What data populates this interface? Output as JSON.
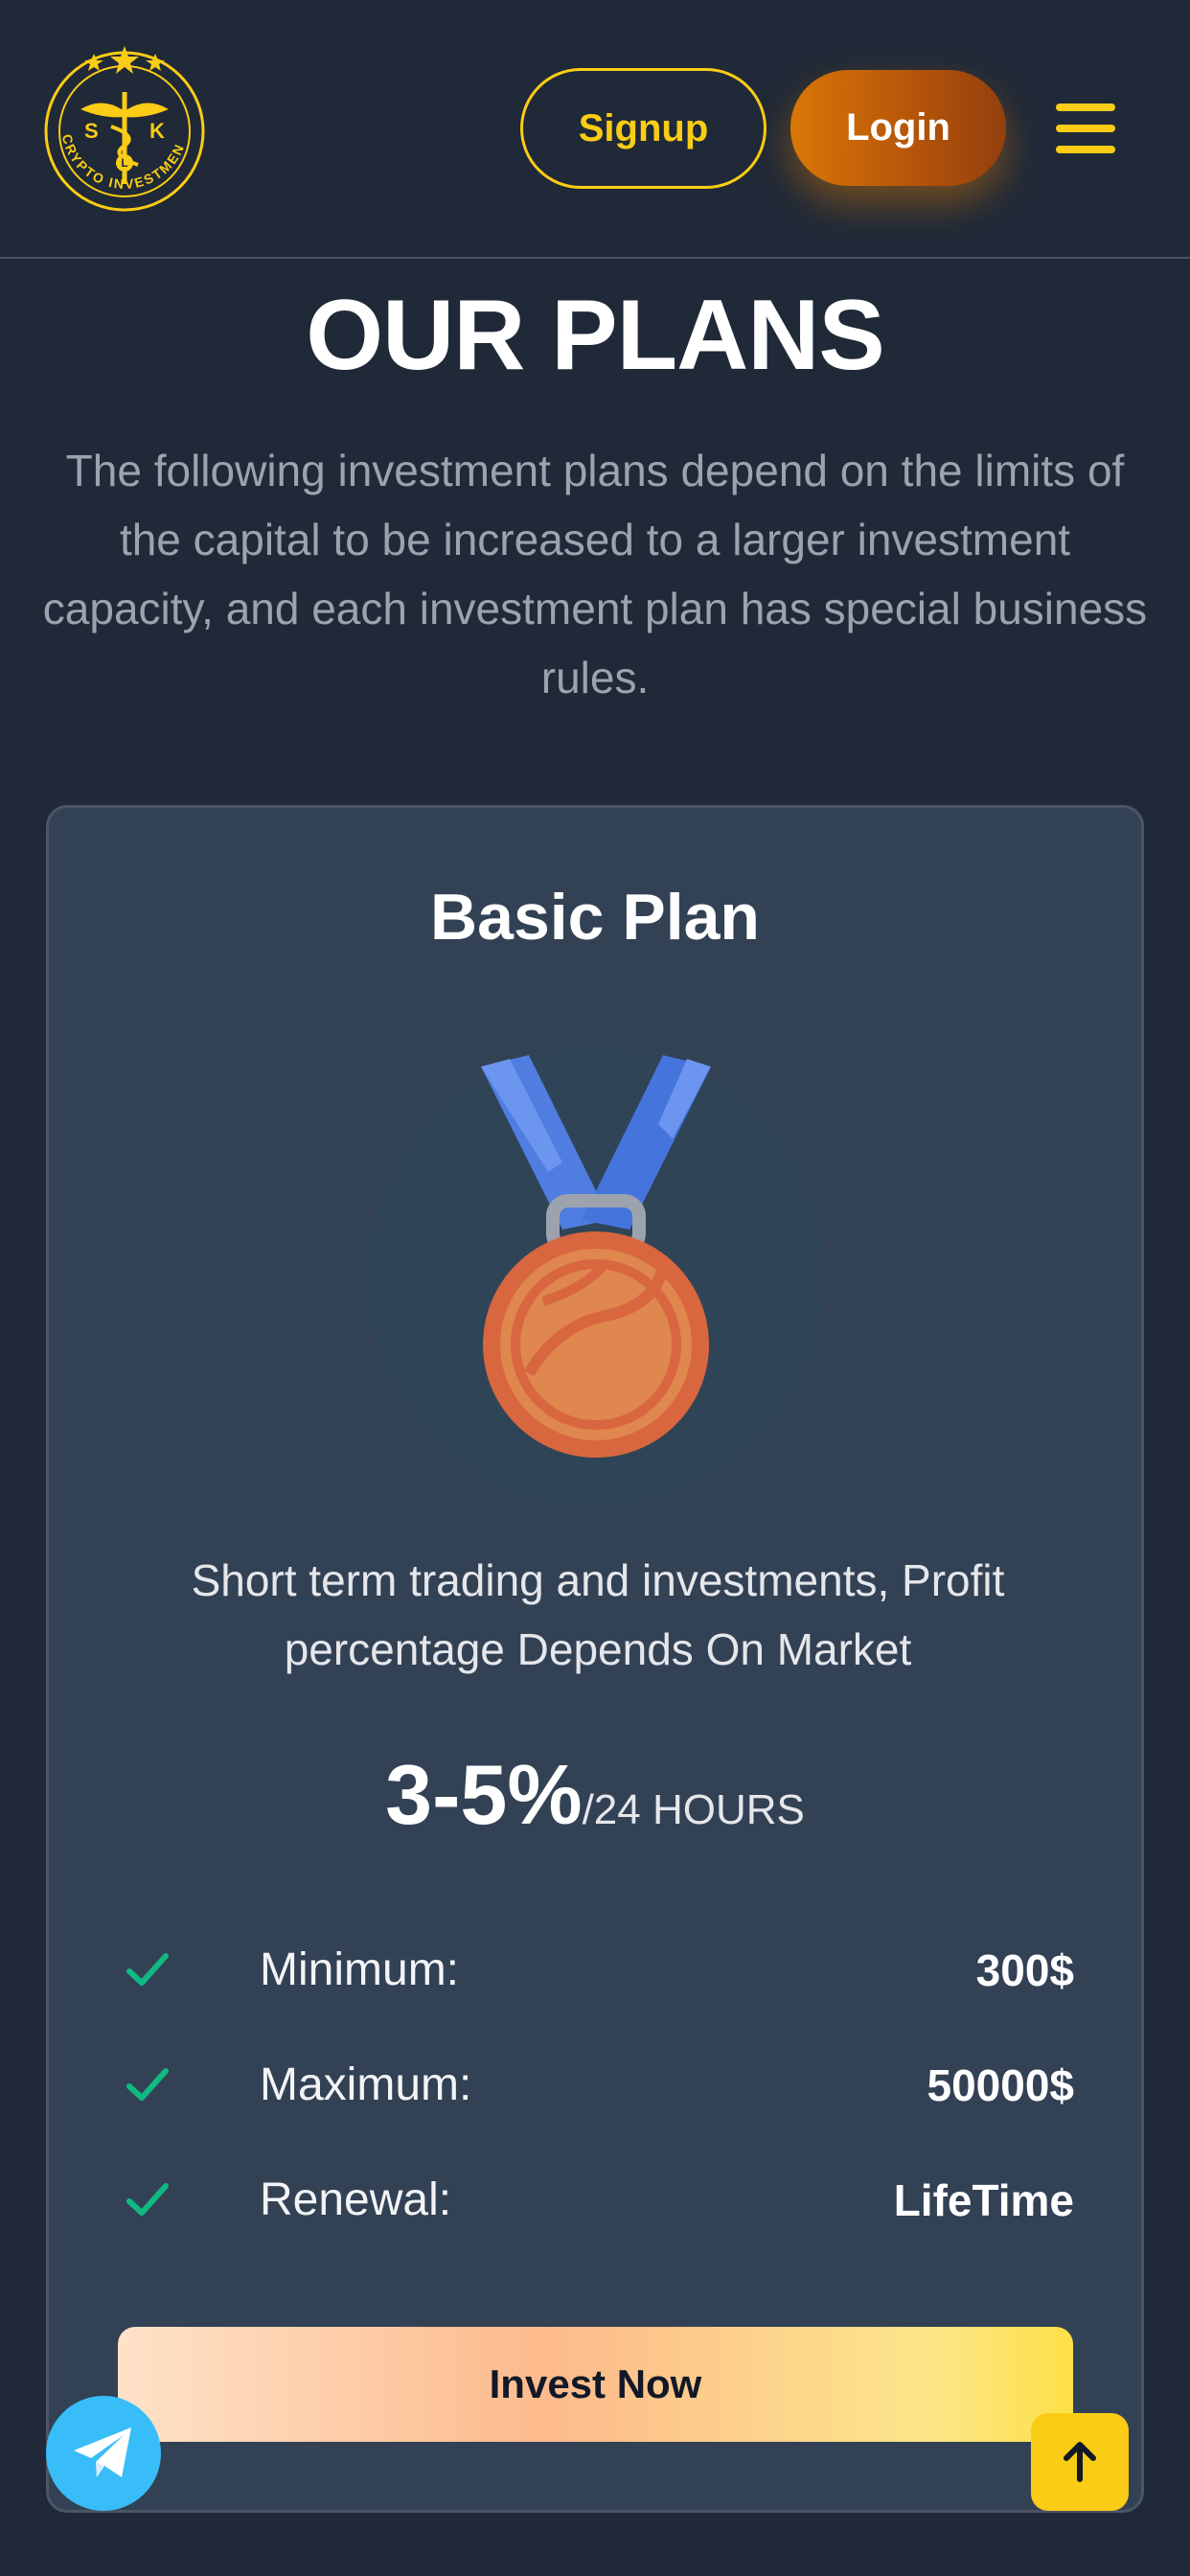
{
  "header": {
    "logo": {
      "initials": [
        "S",
        "K",
        "L"
      ],
      "ring_text": "CRYPTO INVESTMENT",
      "icon": "caduceus-logo-icon"
    },
    "signup_label": "Signup",
    "login_label": "Login",
    "menu_icon": "hamburger-menu-icon"
  },
  "page": {
    "title": "OUR PLANS",
    "intro": "The following investment plans depend on the limits of the capital to be increased to a larger investment capacity, and each investment plan has special business rules."
  },
  "plan": {
    "name": "Basic Plan",
    "badge_icon": "bronze-medal-icon",
    "description": "Short term trading and investments, Profit percentage Depends On Market",
    "rate": "3-5%",
    "period": "/24 HOURS",
    "features": [
      {
        "label": "Minimum:",
        "value": "300$"
      },
      {
        "label": "Maximum:",
        "value": "50000$"
      },
      {
        "label": "Renewal:",
        "value": "LifeTime"
      }
    ],
    "cta_label": "Invest Now"
  },
  "floating": {
    "telegram_icon": "telegram-icon",
    "scroll_top_icon": "arrow-up-icon"
  },
  "colors": {
    "background": "#1f2937",
    "card": "#334155",
    "accent": "#facc15",
    "login": "#d97706",
    "check": "#10b981",
    "telegram": "#38bdf8"
  }
}
